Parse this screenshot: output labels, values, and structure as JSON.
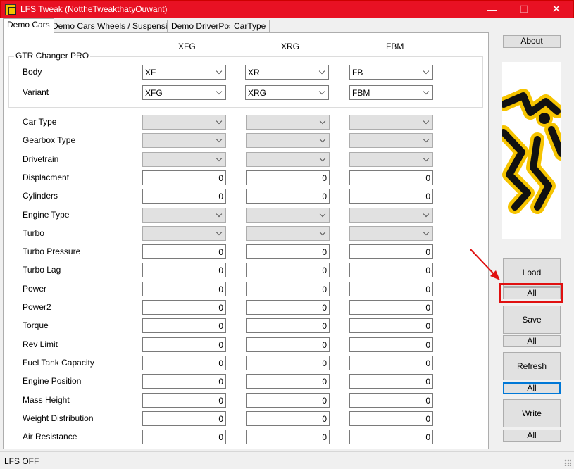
{
  "window": {
    "title": "LFS Tweak (NottheTweakthatyOuwant)",
    "min_glyph": "—",
    "max_glyph": "☐",
    "close_glyph": "✕"
  },
  "tabs": [
    {
      "label": "Demo Cars",
      "active": true
    },
    {
      "label": "Demo Cars Wheels / Suspension",
      "active": false
    },
    {
      "label": "Demo DriverPos",
      "active": false
    },
    {
      "label": "CarType",
      "active": false
    }
  ],
  "columns": [
    "XFG",
    "XRG",
    "FBM"
  ],
  "gtr": {
    "title": "GTR Changer PRO",
    "body_label": "Body",
    "variant_label": "Variant",
    "body": [
      "XF",
      "XR",
      "FB"
    ],
    "variant": [
      "XFG",
      "XRG",
      "FBM"
    ]
  },
  "rows": [
    {
      "label": "Car Type",
      "kind": "combo",
      "values": [
        "",
        "",
        ""
      ]
    },
    {
      "label": "Gearbox Type",
      "kind": "combo",
      "values": [
        "",
        "",
        ""
      ]
    },
    {
      "label": "Drivetrain",
      "kind": "combo",
      "values": [
        "",
        "",
        ""
      ]
    },
    {
      "label": "Displacment",
      "kind": "num",
      "values": [
        "0",
        "0",
        "0"
      ]
    },
    {
      "label": "Cylinders",
      "kind": "num",
      "values": [
        "0",
        "0",
        "0"
      ]
    },
    {
      "label": "Engine Type",
      "kind": "combo",
      "values": [
        "",
        "",
        ""
      ]
    },
    {
      "label": "Turbo",
      "kind": "combo",
      "values": [
        "",
        "",
        ""
      ]
    },
    {
      "label": "Turbo Pressure",
      "kind": "num",
      "values": [
        "0",
        "0",
        "0"
      ]
    },
    {
      "label": "Turbo Lag",
      "kind": "num",
      "values": [
        "0",
        "0",
        "0"
      ]
    },
    {
      "label": "Power",
      "kind": "num",
      "values": [
        "0",
        "0",
        "0"
      ]
    },
    {
      "label": "Power2",
      "kind": "num",
      "values": [
        "0",
        "0",
        "0"
      ]
    },
    {
      "label": "Torque",
      "kind": "num",
      "values": [
        "0",
        "0",
        "0"
      ]
    },
    {
      "label": "Rev Limit",
      "kind": "num",
      "values": [
        "0",
        "0",
        "0"
      ]
    },
    {
      "label": "Fuel Tank Capacity",
      "kind": "num",
      "values": [
        "0",
        "0",
        "0"
      ]
    },
    {
      "label": "Engine Position",
      "kind": "num",
      "values": [
        "0",
        "0",
        "0"
      ]
    },
    {
      "label": "Mass Height",
      "kind": "num",
      "values": [
        "0",
        "0",
        "0"
      ]
    },
    {
      "label": "Weight Distribution",
      "kind": "num",
      "values": [
        "0",
        "0",
        "0"
      ]
    },
    {
      "label": "Air Resistance",
      "kind": "num",
      "values": [
        "0",
        "0",
        "0"
      ]
    }
  ],
  "right_panel": {
    "about": "About",
    "load": "Load",
    "load_all": "All",
    "save": "Save",
    "save_all": "All",
    "refresh": "Refresh",
    "refresh_all": "All",
    "write": "Write",
    "write_all": "All"
  },
  "colors": {
    "titlebar": "#e81123",
    "annotation": "#e01010",
    "logo_yellow": "#f6c400",
    "logo_black": "#111111"
  },
  "status": {
    "text": "LFS OFF"
  }
}
